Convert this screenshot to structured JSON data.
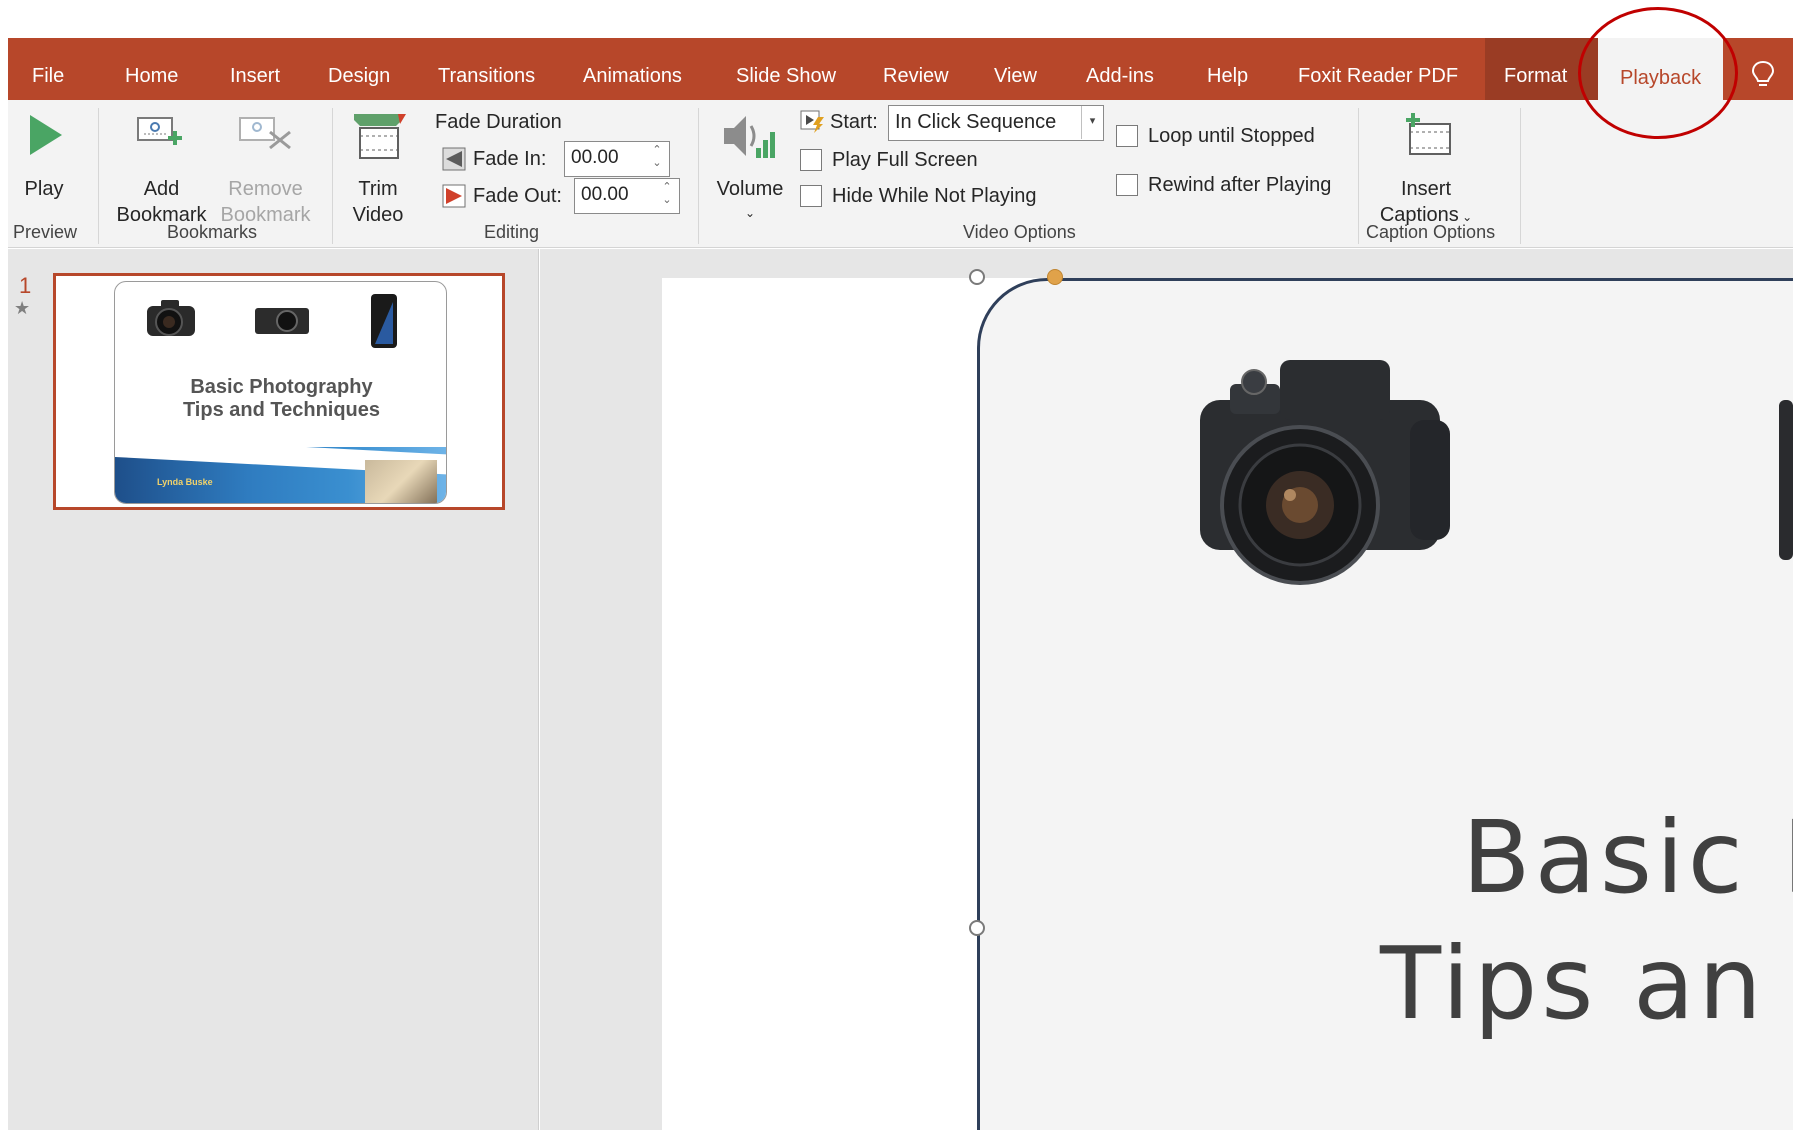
{
  "tabs": [
    {
      "label": "File"
    },
    {
      "label": "Home"
    },
    {
      "label": "Insert"
    },
    {
      "label": "Design"
    },
    {
      "label": "Transitions"
    },
    {
      "label": "Animations"
    },
    {
      "label": "Slide Show"
    },
    {
      "label": "Review"
    },
    {
      "label": "View"
    },
    {
      "label": "Add-ins"
    },
    {
      "label": "Help"
    },
    {
      "label": "Foxit Reader PDF"
    },
    {
      "label": "Format"
    },
    {
      "label": "Playback",
      "active": true
    }
  ],
  "ribbon": {
    "preview": {
      "group": "Preview",
      "play": "Play"
    },
    "bookmarks": {
      "group": "Bookmarks",
      "add_line1": "Add",
      "add_line2": "Bookmark",
      "remove_line1": "Remove",
      "remove_line2": "Bookmark"
    },
    "editing": {
      "group": "Editing",
      "trim_line1": "Trim",
      "trim_line2": "Video",
      "fade_duration": "Fade Duration",
      "fade_in_label": "Fade In:",
      "fade_in_value": "00.00",
      "fade_out_label": "Fade Out:",
      "fade_out_value": "00.00"
    },
    "video_options": {
      "group": "Video Options",
      "volume": "Volume",
      "start_label": "Start:",
      "start_value": "In Click Sequence",
      "play_full_screen": "Play Full Screen",
      "hide_while_not_playing": "Hide While Not Playing",
      "loop_until_stopped": "Loop until Stopped",
      "rewind_after_playing": "Rewind after Playing"
    },
    "caption_options": {
      "group": "Caption Options",
      "insert_line1": "Insert",
      "insert_line2": "Captions"
    }
  },
  "thumbnail": {
    "slide_number": "1",
    "title_line1": "Basic Photography",
    "title_line2": "Tips and Techniques",
    "author": "Lynda Buske"
  },
  "slide": {
    "title_line1": "Basic P",
    "title_line2": "Tips an"
  },
  "icons": {
    "play": "play-icon",
    "add_bookmark": "add-bookmark-icon",
    "remove_bookmark": "remove-bookmark-icon",
    "trim": "trim-video-icon",
    "volume": "volume-icon",
    "insert_captions": "insert-captions-icon",
    "tell_me": "lightbulb-icon"
  },
  "colors": {
    "accent": "#b7472a",
    "annotation": "#c00000"
  }
}
